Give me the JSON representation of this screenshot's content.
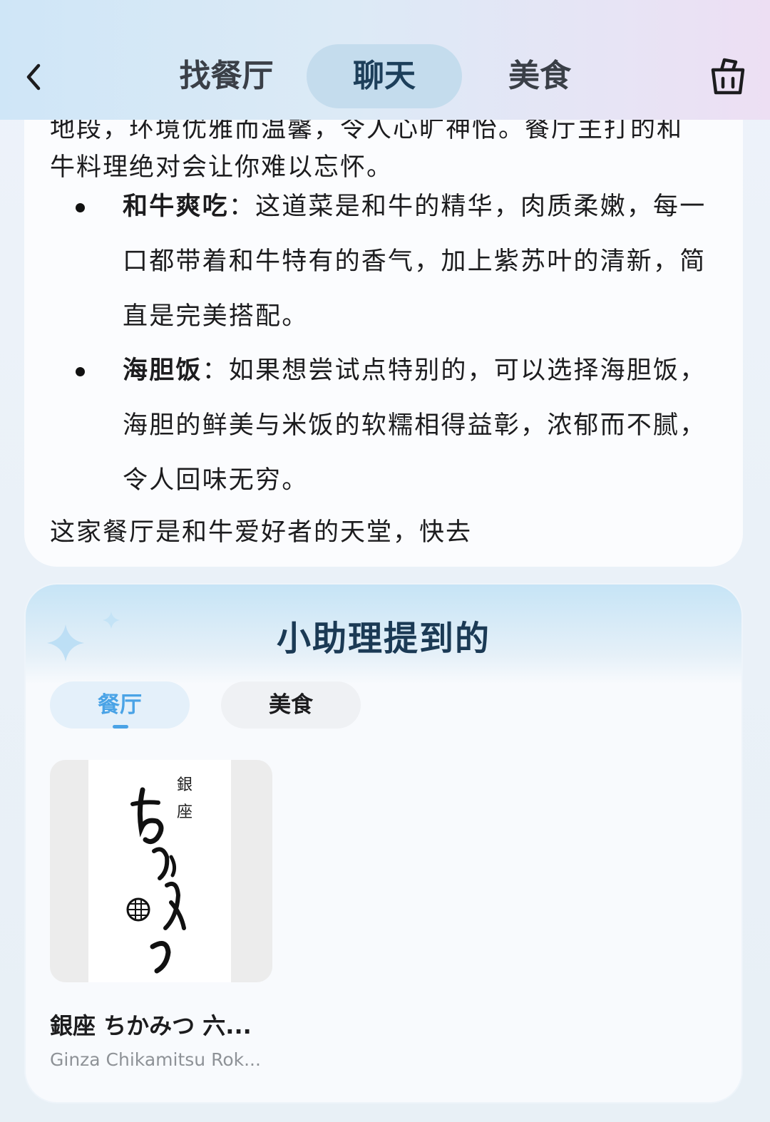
{
  "header": {
    "tabs": [
      {
        "label": "找餐厅"
      },
      {
        "label": "聊天"
      },
      {
        "label": "美食"
      }
    ],
    "active_tab": "聊天"
  },
  "chat": {
    "partial_line": "地段，环境优雅而温馨，令人心旷神怡。餐厅主打的和",
    "line_2": "牛料理绝对会让你难以忘怀。",
    "bullets": [
      {
        "title": "和牛爽吃",
        "body": "：这道菜是和牛的精华，肉质柔嫩，每一口都带着和牛特有的香气，加上紫苏叶的清新，简直是完美搭配。"
      },
      {
        "title": "海胆饭",
        "body": "：如果想尝试点特别的，可以选择海胆饭，海胆的鲜美与米饭的软糯相得益彰，浓郁而不腻，令人回味无穷。"
      }
    ],
    "closing_line": "这家餐厅是和牛爱好者的天堂，快去"
  },
  "assistant": {
    "title": "小助理提到的",
    "pills": [
      {
        "label": "餐厅"
      },
      {
        "label": "美食"
      }
    ],
    "active_pill": "餐厅",
    "restaurant": {
      "logo_text": "銀座 ちかみつ",
      "name": "銀座 ちかみつ 六...",
      "subtitle": "Ginza Chikamitsu Rok..."
    }
  },
  "colors": {
    "accent_blue": "#4aa3e6",
    "title_navy": "#1b3a55",
    "active_tab_bg": "#c4dced"
  },
  "icons": [
    "back-chevron-icon",
    "basket-icon",
    "sparkle-icon"
  ]
}
